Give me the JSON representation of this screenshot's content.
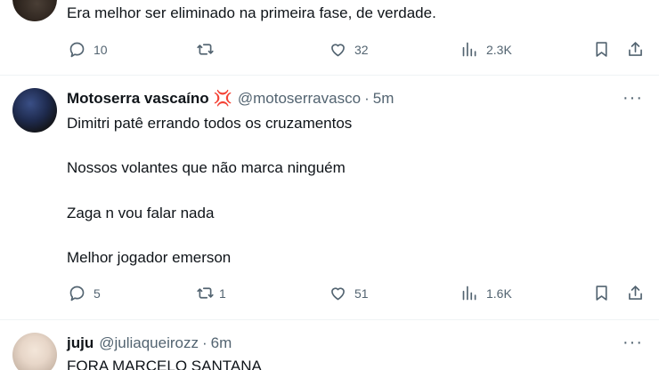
{
  "tweets": [
    {
      "text_lines": [
        "Era melhor ser eliminado na primeira fase, de verdade."
      ],
      "replies": "10",
      "retweets": "",
      "likes": "32",
      "views": "2.3K"
    },
    {
      "name": "Motoserra vascaíno",
      "badge": "💢",
      "handle": "@motoserravasco",
      "separator": "·",
      "time": "5m",
      "text_lines": [
        "Dimitri patê errando todos os cruzamentos",
        "Nossos volantes que não marca ninguém",
        "Zaga n vou falar nada",
        "Melhor jogador emerson"
      ],
      "replies": "5",
      "retweets": "1",
      "likes": "51",
      "views": "1.6K"
    },
    {
      "name": "juju",
      "handle": "@juliaqueirozz",
      "separator": "·",
      "time": "6m",
      "text_lines": [
        "FORA MARCELO SANTANA"
      ]
    }
  ],
  "more_label": "···",
  "icons": {
    "reply": "reply-icon",
    "retweet": "retweet-icon",
    "like": "heart-icon",
    "views": "views-icon",
    "bookmark": "bookmark-icon",
    "share": "share-icon"
  }
}
